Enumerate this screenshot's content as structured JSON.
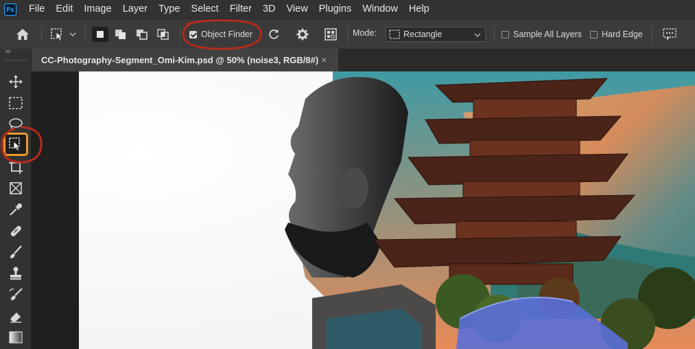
{
  "app": {
    "logo_text": "Ps"
  },
  "menubar": {
    "items": [
      "File",
      "Edit",
      "Image",
      "Layer",
      "Type",
      "Select",
      "Filter",
      "3D",
      "View",
      "Plugins",
      "Window",
      "Help"
    ]
  },
  "options": {
    "object_finder": {
      "label": "Object Finder",
      "checked": true
    },
    "mode_label": "Mode:",
    "mode_value": "Rectangle",
    "sample_all_layers": {
      "label": "Sample All Layers",
      "checked": false
    },
    "hard_edge": {
      "label": "Hard Edge",
      "checked": false
    }
  },
  "document": {
    "tab_title": "CC-Photography-Segment_Omi-Kim.psd @ 50% (noise3, RGB/8#)",
    "close_glyph": "×"
  },
  "toolbar": {
    "collapse_glyph": "››",
    "active_tool": "object-selection-tool"
  },
  "colors": {
    "accent_orange": "#e89a2c",
    "annotation_red": "#b52a1d",
    "menubar_bg": "#323232",
    "options_bg": "#3b3b3b"
  }
}
